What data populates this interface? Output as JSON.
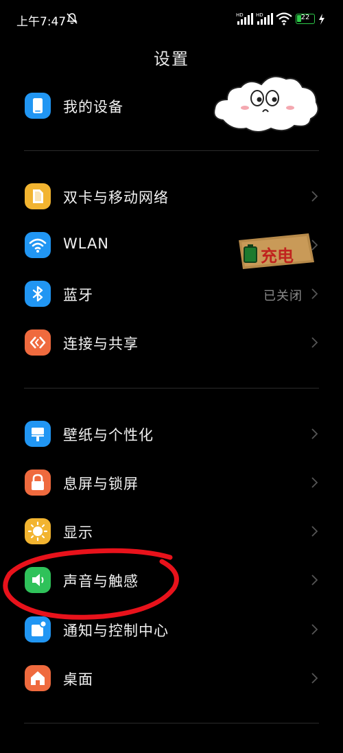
{
  "status": {
    "time": "上午7:47",
    "battery": "22"
  },
  "page": {
    "title": "设置"
  },
  "items": {
    "my_device": {
      "label": "我的设备"
    },
    "dual_sim": {
      "label": "双卡与移动网络"
    },
    "wlan": {
      "label": "WLAN"
    },
    "bluetooth": {
      "label": "蓝牙",
      "value": "已关闭"
    },
    "connection": {
      "label": "连接与共享"
    },
    "wallpaper": {
      "label": "壁纸与个性化"
    },
    "lockscreen": {
      "label": "息屏与锁屏"
    },
    "display": {
      "label": "显示"
    },
    "sound": {
      "label": "声音与触感"
    },
    "notifications": {
      "label": "通知与控制中心"
    },
    "home": {
      "label": "桌面"
    }
  },
  "stickers": {
    "charge_text": "充电"
  },
  "colors": {
    "background": "#000000",
    "blue": "#2196f3",
    "yellow": "#f2b430",
    "orange": "#ef6a3e",
    "green": "#2fc25a",
    "annotation_red": "#e8121b"
  },
  "icons": {
    "my_device": "phone-icon",
    "dual_sim": "sim-card-icon",
    "wlan": "wifi-icon",
    "bluetooth": "bluetooth-icon",
    "connection": "share-icon",
    "wallpaper": "brush-icon",
    "lockscreen": "lock-icon",
    "display": "sun-icon",
    "sound": "speaker-icon",
    "notifications": "notification-icon",
    "home": "house-icon"
  }
}
